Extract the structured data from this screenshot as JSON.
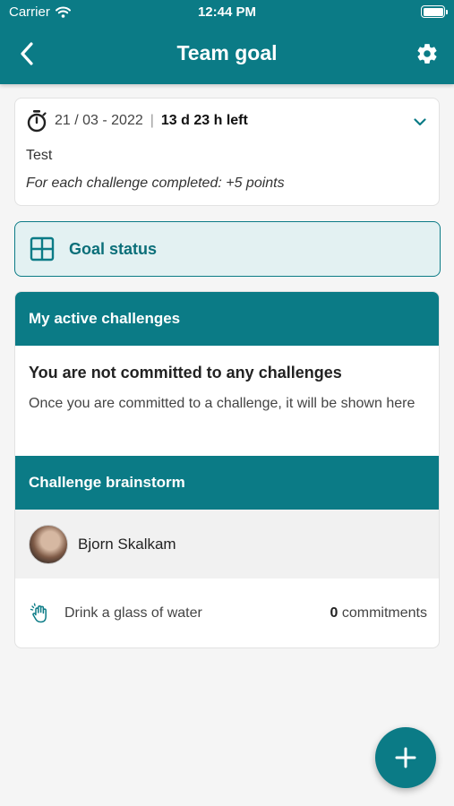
{
  "status_bar": {
    "carrier": "Carrier",
    "time": "12:44 PM"
  },
  "nav": {
    "title": "Team goal",
    "back_icon": "back-chevron-icon",
    "settings_icon": "gear-icon"
  },
  "goal_info": {
    "date": "21 / 03 - 2022",
    "separator": "|",
    "time_left": "13 d 23 h  left",
    "description": "Test",
    "rule": "For each challenge completed: +5 points"
  },
  "goal_status": {
    "label": "Goal status"
  },
  "active_challenges": {
    "header": "My active challenges",
    "empty_title": "You are not committed to any challenges",
    "empty_text": "Once you are committed to a challenge, it will be shown here"
  },
  "brainstorm": {
    "header": "Challenge brainstorm",
    "user_name": "Bjorn Skalkam",
    "challenge": {
      "label": "Drink a glass of water",
      "count": "0",
      "count_label": "commitments"
    }
  },
  "colors": {
    "primary": "#0b7b86",
    "status_bg": "#e3f1f2",
    "background": "#f5f5f5"
  }
}
